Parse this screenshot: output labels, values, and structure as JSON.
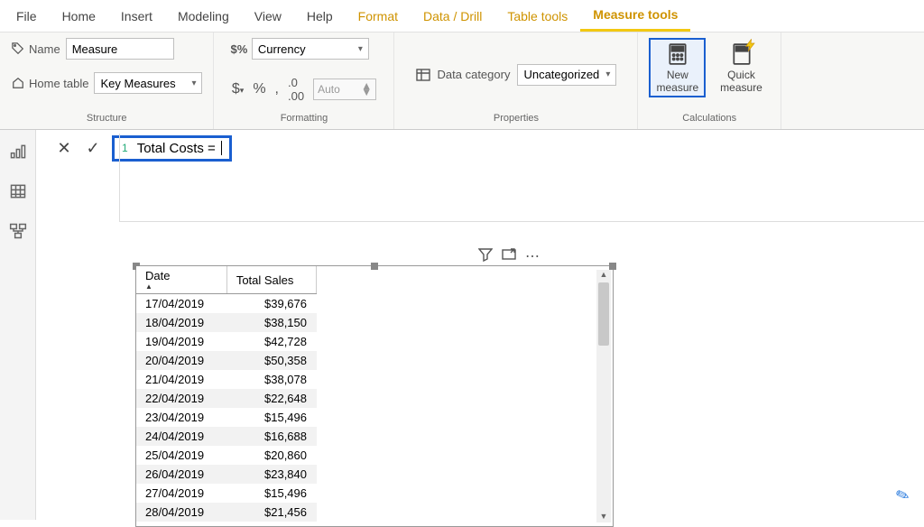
{
  "tabs": {
    "file": "File",
    "home": "Home",
    "insert": "Insert",
    "modeling": "Modeling",
    "view": "View",
    "help": "Help",
    "format": "Format",
    "datadrill": "Data / Drill",
    "tabletools": "Table tools",
    "measuretools": "Measure tools"
  },
  "structure": {
    "name_label": "Name",
    "name_value": "Measure",
    "home_table_label": "Home table",
    "home_table_value": "Key Measures",
    "group": "Structure"
  },
  "formatting": {
    "format_value": "Currency",
    "auto_value": "Auto",
    "group": "Formatting"
  },
  "properties": {
    "data_category_label": "Data category",
    "data_category_value": "Uncategorized",
    "group": "Properties"
  },
  "calculations": {
    "new_measure": "New measure",
    "quick_measure": "Quick measure",
    "group": "Calculations"
  },
  "formula": {
    "line": "1",
    "text": "Total Costs ="
  },
  "table": {
    "cols": [
      "Date",
      "Total Sales"
    ]
  },
  "chart_data": {
    "type": "table",
    "columns": [
      "Date",
      "Total Sales"
    ],
    "rows": [
      [
        "17/04/2019",
        "$39,676"
      ],
      [
        "18/04/2019",
        "$38,150"
      ],
      [
        "19/04/2019",
        "$42,728"
      ],
      [
        "20/04/2019",
        "$50,358"
      ],
      [
        "21/04/2019",
        "$38,078"
      ],
      [
        "22/04/2019",
        "$22,648"
      ],
      [
        "23/04/2019",
        "$15,496"
      ],
      [
        "24/04/2019",
        "$16,688"
      ],
      [
        "25/04/2019",
        "$20,860"
      ],
      [
        "26/04/2019",
        "$23,840"
      ],
      [
        "27/04/2019",
        "$15,496"
      ],
      [
        "28/04/2019",
        "$21,456"
      ]
    ]
  }
}
